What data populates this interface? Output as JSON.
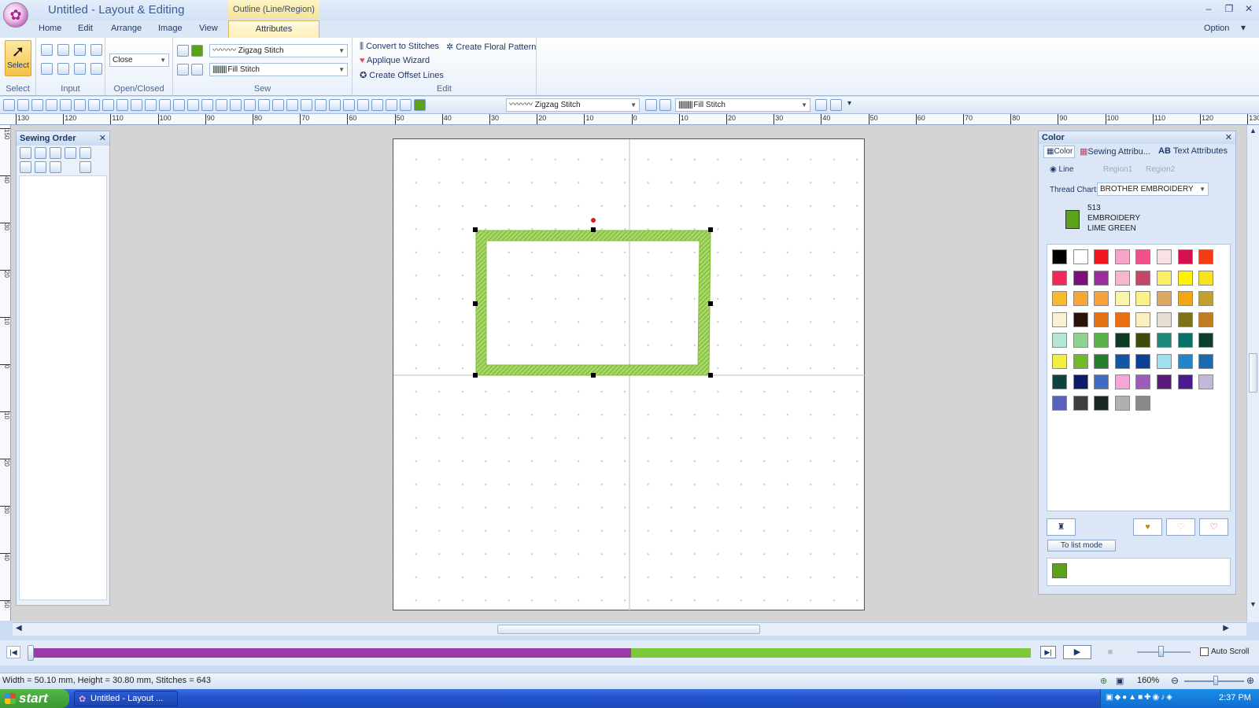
{
  "window": {
    "title": "Untitled - Layout & Editing",
    "context_tab": "Outline (Line/Region)",
    "minimize": "–",
    "restore": "❐",
    "close": "✕"
  },
  "tabs": [
    "Home",
    "Edit",
    "Arrange",
    "Image",
    "View",
    "Attributes"
  ],
  "option_label": "Option",
  "ribbon": {
    "select_label": "Select",
    "group_select": "Select",
    "group_input": "Input",
    "group_open_closed": "Open/Closed",
    "open_closed_value": "Close",
    "group_sew": "Sew",
    "line_stitch": "Zigzag Stitch",
    "region_stitch": "Fill Stitch",
    "group_edit": "Edit",
    "convert_to_stitches": "Convert to Stitches",
    "create_floral_pattern": "Create Floral Pattern",
    "applique_wizard": "Applique Wizard",
    "create_offset_lines": "Create Offset Lines"
  },
  "toolbar2": {
    "line_stitch": "Zigzag Stitch",
    "region_stitch": "Fill Stitch"
  },
  "sewing_order": {
    "title": "Sewing Order"
  },
  "color_panel": {
    "title": "Color",
    "tabs": [
      "Color",
      "Sewing Attribu...",
      "Text Attributes"
    ],
    "targets": [
      "Line",
      "Region1",
      "Region2"
    ],
    "thread_chart_label": "Thread Chart:",
    "thread_chart_value": "BROTHER EMBROIDERY",
    "current_thread": {
      "number": "513",
      "brand": "EMBROIDERY",
      "name": "LIME GREEN",
      "color": "#5ba21b"
    },
    "to_list_mode": "To list mode",
    "swatches": [
      "#000000",
      "#ffffff",
      "#f0141e",
      "#f6a5c8",
      "#f2508a",
      "#fbe0e6",
      "#d4104e",
      "#f23c14",
      "#ed2a5a",
      "#7a1078",
      "#9b2e9c",
      "#f5b8c8",
      "#c34868",
      "#faf064",
      "#fff200",
      "#f9e31c",
      "#f8b932",
      "#f9a531",
      "#f7a23c",
      "#fbf5a8",
      "#fcf186",
      "#dba963",
      "#f1a70f",
      "#c3a02e",
      "#faf1d5",
      "#2b1208",
      "#e07212",
      "#ec6d12",
      "#fbf0c1",
      "#e6ddd3",
      "#7e7118",
      "#c17c22",
      "#b6e6d6",
      "#8ed28e",
      "#5ab34a",
      "#0e3a24",
      "#3b4c0e",
      "#1b8a7a",
      "#067265",
      "#0c3e2b",
      "#f1ef42",
      "#72b92b",
      "#277d2f",
      "#1556a3",
      "#0d4292",
      "#9ee1ee",
      "#2384c6",
      "#1a6aad",
      "#0d4240",
      "#0f1a6e",
      "#3e6bc3",
      "#f5a6d6",
      "#9c5cb8",
      "#5a1a7a",
      "#4a1a8e",
      "#c2b8dc",
      "#5a62b8",
      "#3c3f3c",
      "#1a2623",
      "#b0b0b0",
      "#8a8a8a"
    ]
  },
  "status": {
    "dimensions": "Width = 50.10 mm, Height = 30.80 mm, Stitches = 643",
    "zoom": "160%"
  },
  "sim": {
    "auto_scroll": "Auto Scroll",
    "progress": 0.6
  },
  "taskbar": {
    "start": "start",
    "task": "Untitled - Layout ...",
    "clock": "2:37 PM"
  },
  "ruler_top": [
    "130",
    "120",
    "110",
    "100",
    "90",
    "80",
    "70",
    "60",
    "50",
    "40",
    "30",
    "20",
    "10",
    "0",
    "10",
    "20",
    "30",
    "40",
    "50",
    "60",
    "70",
    "80",
    "90",
    "100",
    "110",
    "120",
    "130"
  ],
  "ruler_left": [
    "150",
    "40",
    "30",
    "20",
    "10",
    "0",
    "10",
    "20",
    "30",
    "40",
    "50"
  ],
  "colors": {
    "accent": "#c3d9f3",
    "stitch": "#7dc12e",
    "sim_done": "#9b3aa8",
    "sim_rest": "#7dc93a"
  }
}
